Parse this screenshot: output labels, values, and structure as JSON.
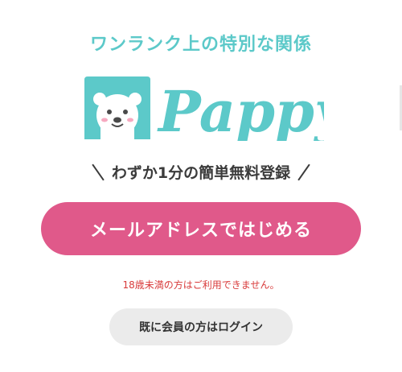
{
  "header": {
    "tagline": "ワンランク上の特別な関係"
  },
  "logo": {
    "wordmark": "Pappy",
    "icon": "bear-face-icon"
  },
  "registration": {
    "subtitle": "わずか1分の簡単無料登録",
    "email_button_label": "メールアドレスではじめる"
  },
  "notice": {
    "age_restriction": "18歳未満の方はご利用できません。"
  },
  "login": {
    "button_label": "既に会員の方はログイン"
  },
  "colors": {
    "brand_teal": "#5cc9c9",
    "cta_pink": "#e0598a",
    "notice_red": "#d83a3a"
  }
}
